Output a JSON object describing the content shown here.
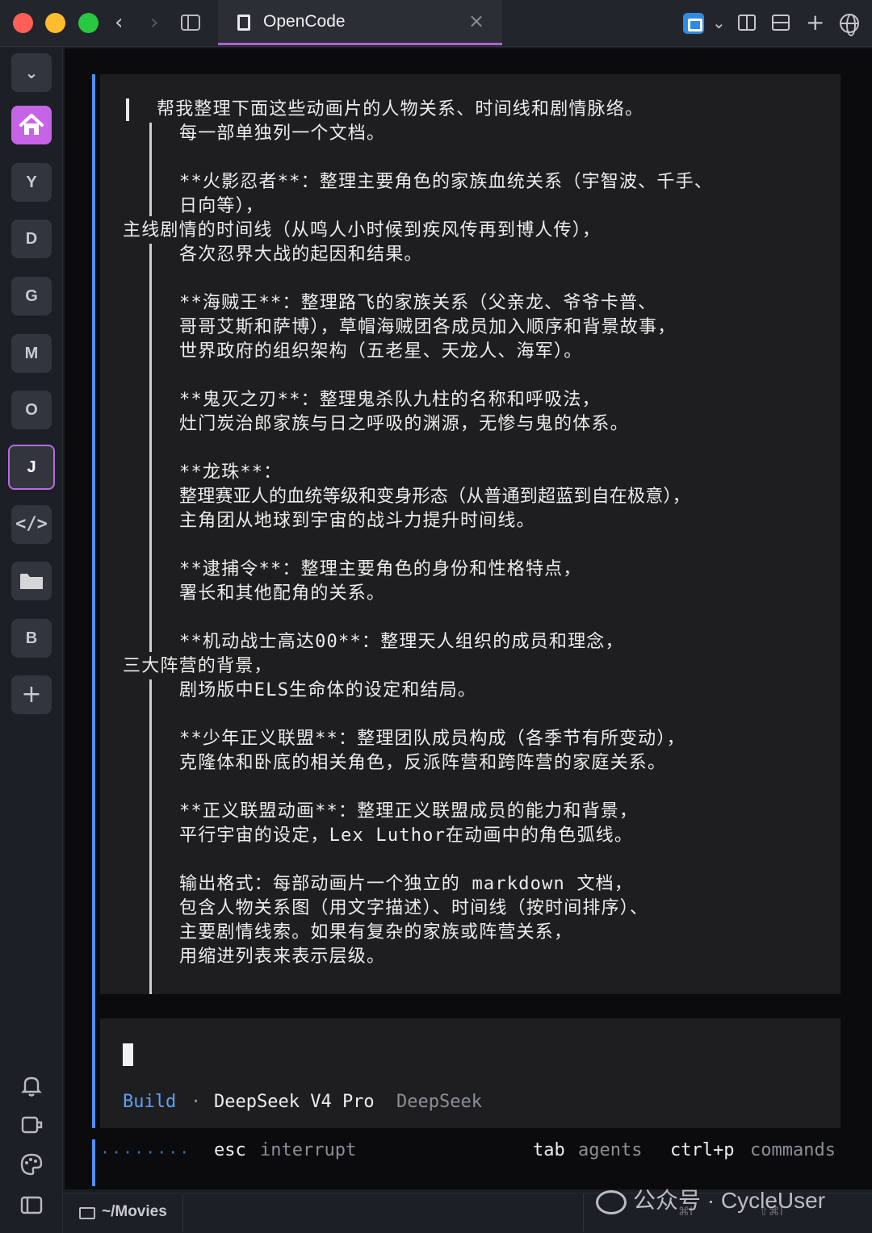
{
  "window": {
    "tab_title": "OpenCode",
    "tab_close": "×",
    "nav_back": "‹",
    "nav_forward": "›",
    "add_tab": "+",
    "dropdown": "⌄"
  },
  "rail": {
    "collapse": "⌄",
    "items": [
      "Y",
      "D",
      "G",
      "M",
      "O",
      "J",
      "B"
    ],
    "code_icon": "</>",
    "add": "+"
  },
  "message": {
    "lines": [
      "帮我整理下面这些动画片的人物关系、时间线和剧情脉络。",
      "每一部单独列一个文档。",
      "**火影忍者**：整理主要角色的家族血统关系（宇智波、千手、",
      "日向等），",
      "主线剧情的时间线（从鸣人小时候到疾风传再到博人传），",
      "各次忍界大战的起因和结果。",
      "**海贼王**：整理路飞的家族关系（父亲龙、爷爷卡普、",
      "哥哥艾斯和萨博），草帽海贼团各成员加入顺序和背景故事，",
      "世界政府的组织架构（五老星、天龙人、海军）。",
      "**鬼灭之刃**：整理鬼杀队九柱的名称和呼吸法，",
      "灶门炭治郎家族与日之呼吸的渊源，无惨与鬼的体系。",
      "**龙珠**：",
      "整理赛亚人的血统等级和变身形态（从普通到超蓝到自在极意），",
      "主角团从地球到宇宙的战斗力提升时间线。",
      "**逮捕令**：整理主要角色的身份和性格特点，",
      "署长和其他配角的关系。",
      "**机动战士高达00**：整理天人组织的成员和理念，",
      "三大阵营的背景，",
      "剧场版中ELS生命体的设定和结局。",
      "**少年正义联盟**：整理团队成员构成（各季节有所变动），",
      "克隆体和卧底的相关角色，反派阵营和跨阵营的家庭关系。",
      "**正义联盟动画**：整理正义联盟成员的能力和背景，",
      "平行宇宙的设定，Lex Luthor在动画中的角色弧线。",
      "输出格式：每部动画片一个独立的 markdown 文档，",
      "包含人物关系图（用文字描述）、时间线（按时间排序）、",
      "主要剧情线索。如果有复杂的家族或阵营关系，",
      "用缩进列表来表示层级。"
    ]
  },
  "input": {
    "mode": "Build",
    "separator": "·",
    "model": "DeepSeek V4 Pro",
    "provider": "DeepSeek"
  },
  "footer": {
    "progress_dots": "········",
    "esc_key": "esc",
    "esc_label": "interrupt",
    "tab_key": "tab",
    "tab_label": "agents",
    "cmd_key": "ctrl+p",
    "cmd_label": "commands"
  },
  "statusbar": {
    "cwd": "~/Movies",
    "watermark": "公众号 · CycleUser",
    "shortcut1": "⌘I",
    "shortcut2": "⇧⌘I"
  }
}
